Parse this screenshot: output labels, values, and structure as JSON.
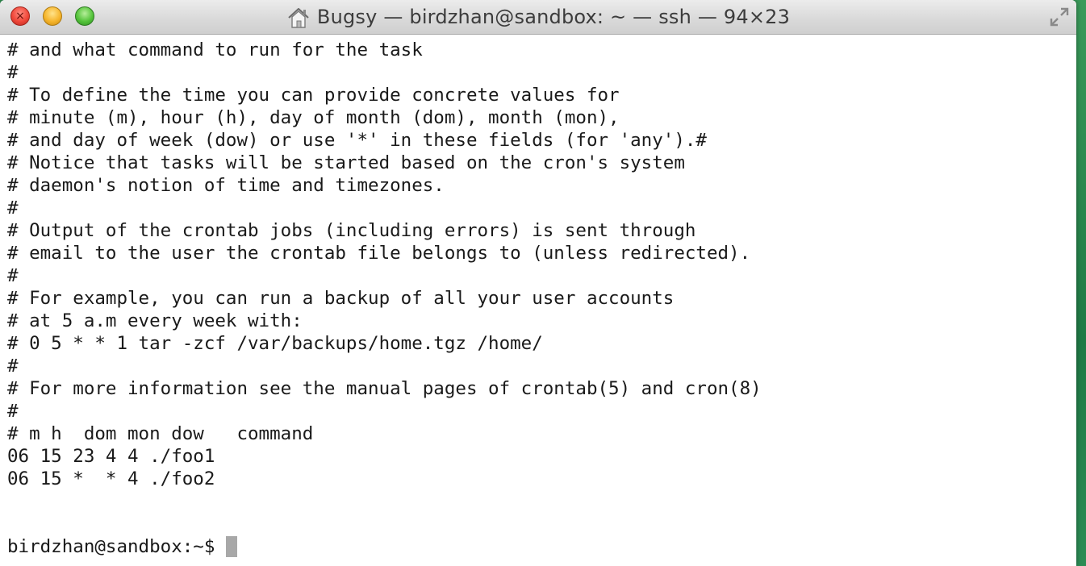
{
  "window": {
    "title": "Bugsy — birdzhan@sandbox: ~ — ssh — 94×23",
    "buttons": {
      "close_glyph": "×"
    },
    "icons": {
      "home": "home-icon",
      "fullscreen": "fullscreen-icon"
    }
  },
  "terminal": {
    "lines": [
      "# and what command to run for the task",
      "#",
      "# To define the time you can provide concrete values for",
      "# minute (m), hour (h), day of month (dom), month (mon),",
      "# and day of week (dow) or use '*' in these fields (for 'any').#",
      "# Notice that tasks will be started based on the cron's system",
      "# daemon's notion of time and timezones.",
      "#",
      "# Output of the crontab jobs (including errors) is sent through",
      "# email to the user the crontab file belongs to (unless redirected).",
      "#",
      "# For example, you can run a backup of all your user accounts",
      "# at 5 a.m every week with:",
      "# 0 5 * * 1 tar -zcf /var/backups/home.tgz /home/",
      "#",
      "# For more information see the manual pages of crontab(5) and cron(8)",
      "#",
      "# m h  dom mon dow   command",
      "06 15 23 4 4 ./foo1",
      "06 15 *  * 4 ./foo2",
      "",
      ""
    ],
    "prompt": "birdzhan@sandbox:~$"
  }
}
